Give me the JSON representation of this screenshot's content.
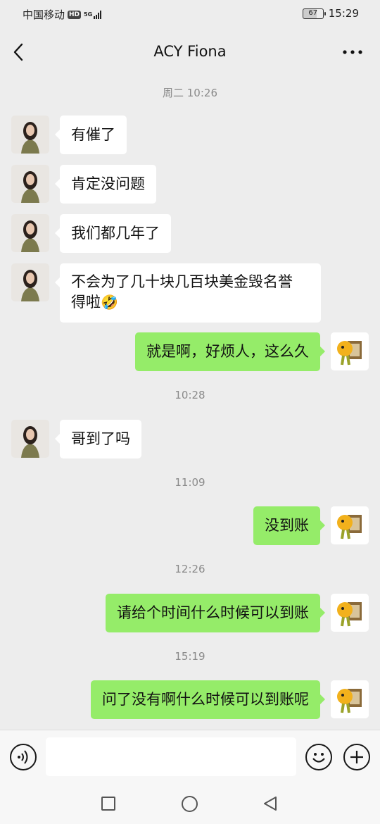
{
  "status_bar": {
    "carrier": "中国移动",
    "hd": "HD",
    "network": "5G",
    "battery": "67",
    "time": "15:29"
  },
  "nav": {
    "title": "ACY Fiona",
    "back_icon": "chevron-left-icon",
    "more_icon": "more-dots-icon"
  },
  "chat": {
    "timestamps": [
      "周二 10:26",
      "10:28",
      "11:09",
      "12:26",
      "15:19"
    ],
    "messages": [
      {
        "side": "left",
        "text": "有催了"
      },
      {
        "side": "left",
        "text": "肯定没问题"
      },
      {
        "side": "left",
        "text": "我们都几年了"
      },
      {
        "side": "left",
        "text": "不会为了几十块几百块美金毁名誉",
        "text2": "得啦",
        "emoji": "🤣"
      },
      {
        "side": "right",
        "text": "就是啊，好烦人，这么久"
      },
      {
        "side": "left",
        "text": "哥到了吗"
      },
      {
        "side": "right",
        "text": "没到账"
      },
      {
        "side": "right",
        "text": "请给个时间什么时候可以到账"
      },
      {
        "side": "right",
        "text": "问了没有啊什么时候可以到账呢"
      }
    ]
  },
  "input_bar": {
    "value": "",
    "voice_icon": "voice-icon",
    "emoji_icon": "emoji-face-icon",
    "plus_icon": "plus-icon"
  },
  "colors": {
    "background": "#ededed",
    "sent_bubble": "#95ec69",
    "received_bubble": "#ffffff"
  }
}
